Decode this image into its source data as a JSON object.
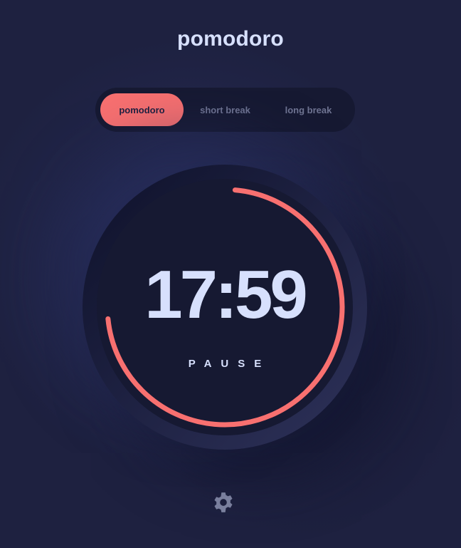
{
  "app": {
    "title": "pomodoro"
  },
  "modes": {
    "items": [
      {
        "label": "pomodoro",
        "active": true
      },
      {
        "label": "short break",
        "active": false
      },
      {
        "label": "long break",
        "active": false
      }
    ]
  },
  "timer": {
    "time": "17:59",
    "action_label": "PAUSE",
    "progress": 0.72
  },
  "settings": {
    "icon": "gear-icon"
  },
  "colors": {
    "background": "#1e2140",
    "accent": "#f87070",
    "text": "#d7e0fd",
    "muted": "#6f7492",
    "panel": "#161932"
  }
}
